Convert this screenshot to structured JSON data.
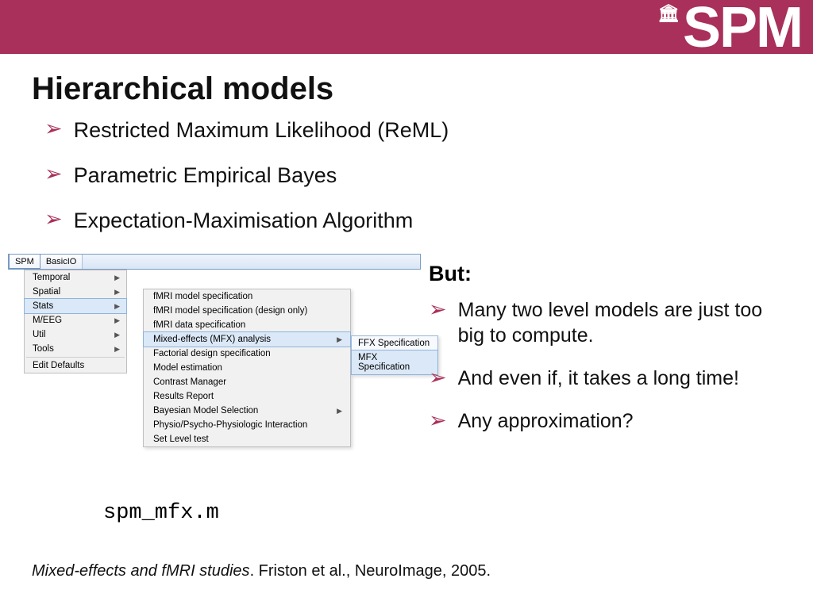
{
  "banner": {
    "logo_text": "SPM",
    "dome_glyph": "🏛"
  },
  "title": "Hierarchical models",
  "bullets_top": [
    "Restricted Maximum Likelihood (ReML)",
    "Parametric Empirical Bayes",
    "Expectation-Maximisation Algorithm"
  ],
  "menu": {
    "tabs": [
      "SPM",
      "BasicIO"
    ],
    "level1": [
      {
        "label": "Temporal",
        "arrow": true
      },
      {
        "label": "Spatial",
        "arrow": true
      },
      {
        "label": "Stats",
        "arrow": true,
        "selected": true
      },
      {
        "label": "M/EEG",
        "arrow": true
      },
      {
        "label": "Util",
        "arrow": true
      },
      {
        "label": "Tools",
        "arrow": true
      },
      {
        "label": "Edit Defaults",
        "arrow": false,
        "sep_before": true
      }
    ],
    "level2": [
      {
        "label": "fMRI model specification"
      },
      {
        "label": "fMRI model specification (design only)"
      },
      {
        "label": "fMRI data specification"
      },
      {
        "label": "Mixed-effects (MFX) analysis",
        "arrow": true,
        "selected": true
      },
      {
        "label": "Factorial design specification"
      },
      {
        "label": "Model estimation"
      },
      {
        "label": "Contrast Manager"
      },
      {
        "label": "Results Report"
      },
      {
        "label": "Bayesian Model Selection",
        "arrow": true
      },
      {
        "label": "Physio/Psycho-Physiologic Interaction"
      },
      {
        "label": "Set Level test"
      }
    ],
    "level3": [
      {
        "label": "FFX Specification"
      },
      {
        "label": "MFX Specification",
        "selected": true
      }
    ]
  },
  "file_label": "spm_mfx.m",
  "right": {
    "heading": "But:",
    "bullets": [
      "Many two level models are just too big to compute.",
      " And even if, it takes a long time!",
      "Any approximation?"
    ]
  },
  "citation": {
    "italic": "Mixed-effects and fMRI studies",
    "rest": ". Friston et al., NeuroImage, 2005."
  },
  "glyphs": {
    "chevron": "➢",
    "submenu_arrow": "▶"
  }
}
